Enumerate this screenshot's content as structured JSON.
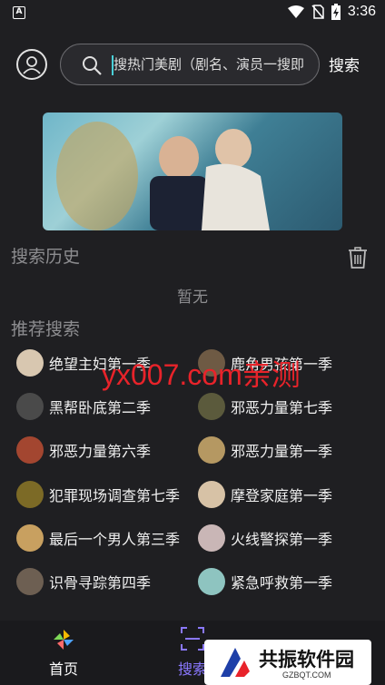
{
  "status_bar": {
    "time": "3:36",
    "app_icon": "A"
  },
  "header": {
    "search_placeholder": "搜热门美剧（剧名、演员一搜即",
    "search_button": "搜索"
  },
  "history": {
    "title": "搜索历史",
    "empty_text": "暂无"
  },
  "recommend": {
    "title": "推荐搜索",
    "items": [
      {
        "label": "绝望主妇第一季",
        "thumb_color": "#d8c7b0"
      },
      {
        "label": "鹿角男孩第一季",
        "thumb_color": "#6e5a44"
      },
      {
        "label": "黑帮卧底第二季",
        "thumb_color": "#4a4a4a"
      },
      {
        "label": "邪恶力量第七季",
        "thumb_color": "#5b5a3c"
      },
      {
        "label": "邪恶力量第六季",
        "thumb_color": "#a34630"
      },
      {
        "label": "邪恶力量第一季",
        "thumb_color": "#b59862"
      },
      {
        "label": "犯罪现场调查第七季",
        "thumb_color": "#7c6a26"
      },
      {
        "label": "摩登家庭第一季",
        "thumb_color": "#d7c2a6"
      },
      {
        "label": "最后一个男人第三季",
        "thumb_color": "#c8a060"
      },
      {
        "label": "火线警探第一季",
        "thumb_color": "#c9b6b6"
      },
      {
        "label": "识骨寻踪第四季",
        "thumb_color": "#6d5f52"
      },
      {
        "label": "紧急呼救第一季",
        "thumb_color": "#8ec4c0"
      }
    ]
  },
  "watermark": "yx007.com亲测",
  "nav": {
    "home": "首页",
    "search": "搜索",
    "active_color": "#8a78ff"
  },
  "badge": {
    "title": "共振软件园",
    "subtitle": "GZBQT.COM"
  }
}
